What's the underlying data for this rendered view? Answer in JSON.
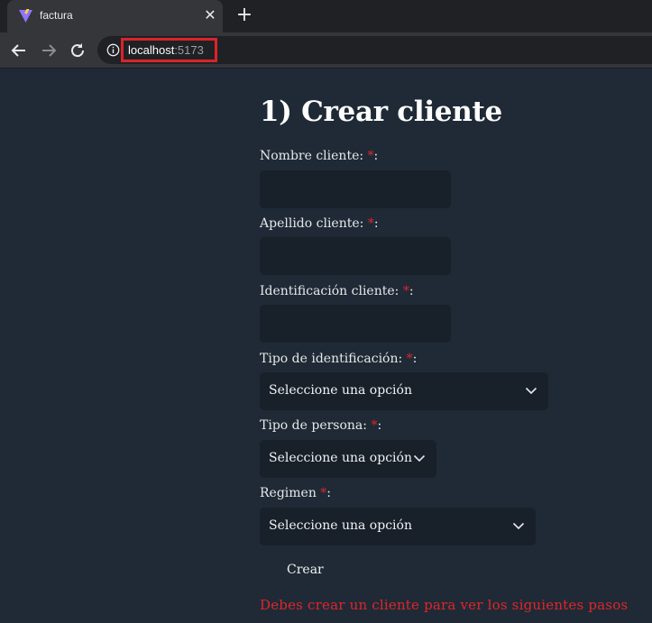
{
  "browser": {
    "tab": {
      "title": "factura",
      "close_glyph": "✕"
    },
    "new_tab_glyph": "+",
    "address": {
      "host": "localhost",
      "port": ":5173"
    },
    "colors": {
      "highlight_border": "#d9242b"
    }
  },
  "page": {
    "title": "1) Crear cliente",
    "required_marker": "*",
    "fields": {
      "nombre": {
        "label": "Nombre cliente: ",
        "suffix": ":",
        "value": ""
      },
      "apellido": {
        "label": "Apellido cliente: ",
        "suffix": ":",
        "value": ""
      },
      "identificacion": {
        "label": "Identificación cliente: ",
        "suffix": ":",
        "value": ""
      },
      "tipo_identificacion": {
        "label": "Tipo de identificación: ",
        "suffix": ":",
        "selected": "Seleccione una opción"
      },
      "tipo_persona": {
        "label": "Tipo de persona: ",
        "suffix": ":",
        "selected": "Seleccione una opción"
      },
      "regimen": {
        "label": "Regimen ",
        "suffix": ":",
        "selected": "Seleccione una opción"
      }
    },
    "create_label": "Crear",
    "warning": "Debes crear un cliente para ver los siguientes pasos",
    "colors": {
      "background": "#1f2a36",
      "input_bg": "#18202a",
      "required": "#e0252c"
    }
  }
}
